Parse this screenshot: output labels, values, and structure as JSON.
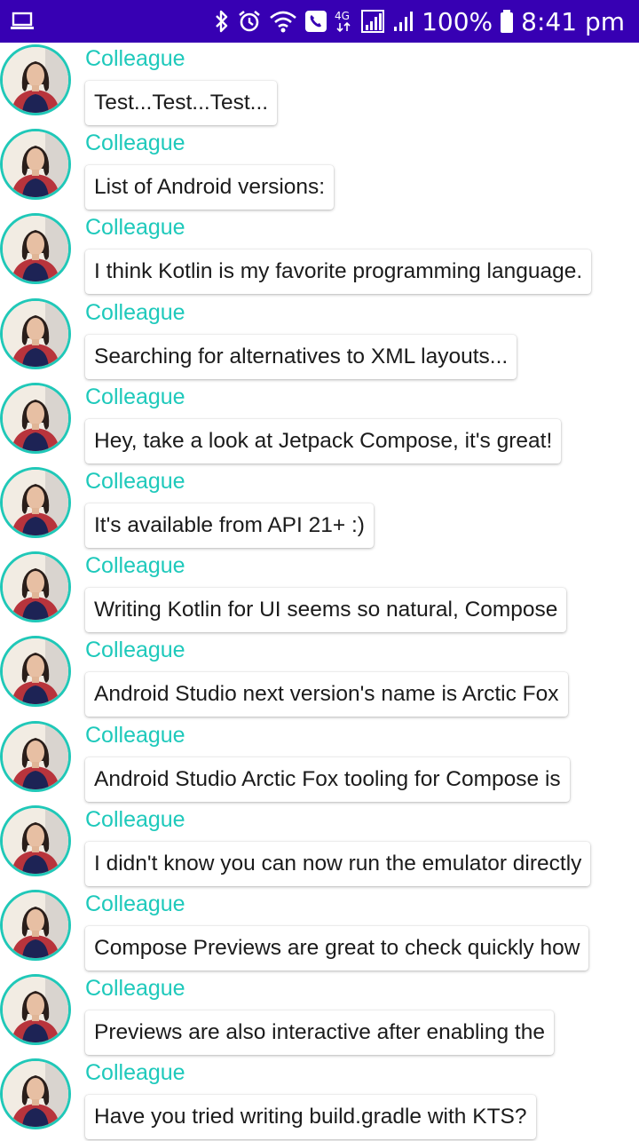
{
  "status_bar": {
    "left_icon": "laptop-icon",
    "icons": [
      "bluetooth-icon",
      "alarm-icon",
      "wifi-icon",
      "call-icon",
      "network-4g-icon",
      "signal-icon",
      "signal-icon",
      "battery-icon"
    ],
    "network_label": "4G",
    "battery": "100%",
    "time": "8:41 pm",
    "background_color": "#3700b3"
  },
  "colors": {
    "author": "#1ec9bb",
    "avatar_border": "#20c8b8"
  },
  "messages": [
    {
      "author": "Colleague",
      "text": "Test...Test...Test..."
    },
    {
      "author": "Colleague",
      "text": "List of Android versions:"
    },
    {
      "author": "Colleague",
      "text": "I think Kotlin is my favorite programming language."
    },
    {
      "author": "Colleague",
      "text": "Searching for alternatives to XML layouts..."
    },
    {
      "author": "Colleague",
      "text": "Hey, take a look at Jetpack Compose, it's great!"
    },
    {
      "author": "Colleague",
      "text": "It's available from API 21+ :)"
    },
    {
      "author": "Colleague",
      "text": "Writing Kotlin for UI seems so natural, Compose"
    },
    {
      "author": "Colleague",
      "text": "Android Studio next version's name is Arctic Fox"
    },
    {
      "author": "Colleague",
      "text": "Android Studio Arctic Fox tooling for Compose is"
    },
    {
      "author": "Colleague",
      "text": "I didn't know you can now run the emulator directly"
    },
    {
      "author": "Colleague",
      "text": "Compose Previews are great to check quickly how"
    },
    {
      "author": "Colleague",
      "text": "Previews are also interactive after enabling the"
    },
    {
      "author": "Colleague",
      "text": "Have you tried writing build.gradle with KTS?"
    }
  ]
}
